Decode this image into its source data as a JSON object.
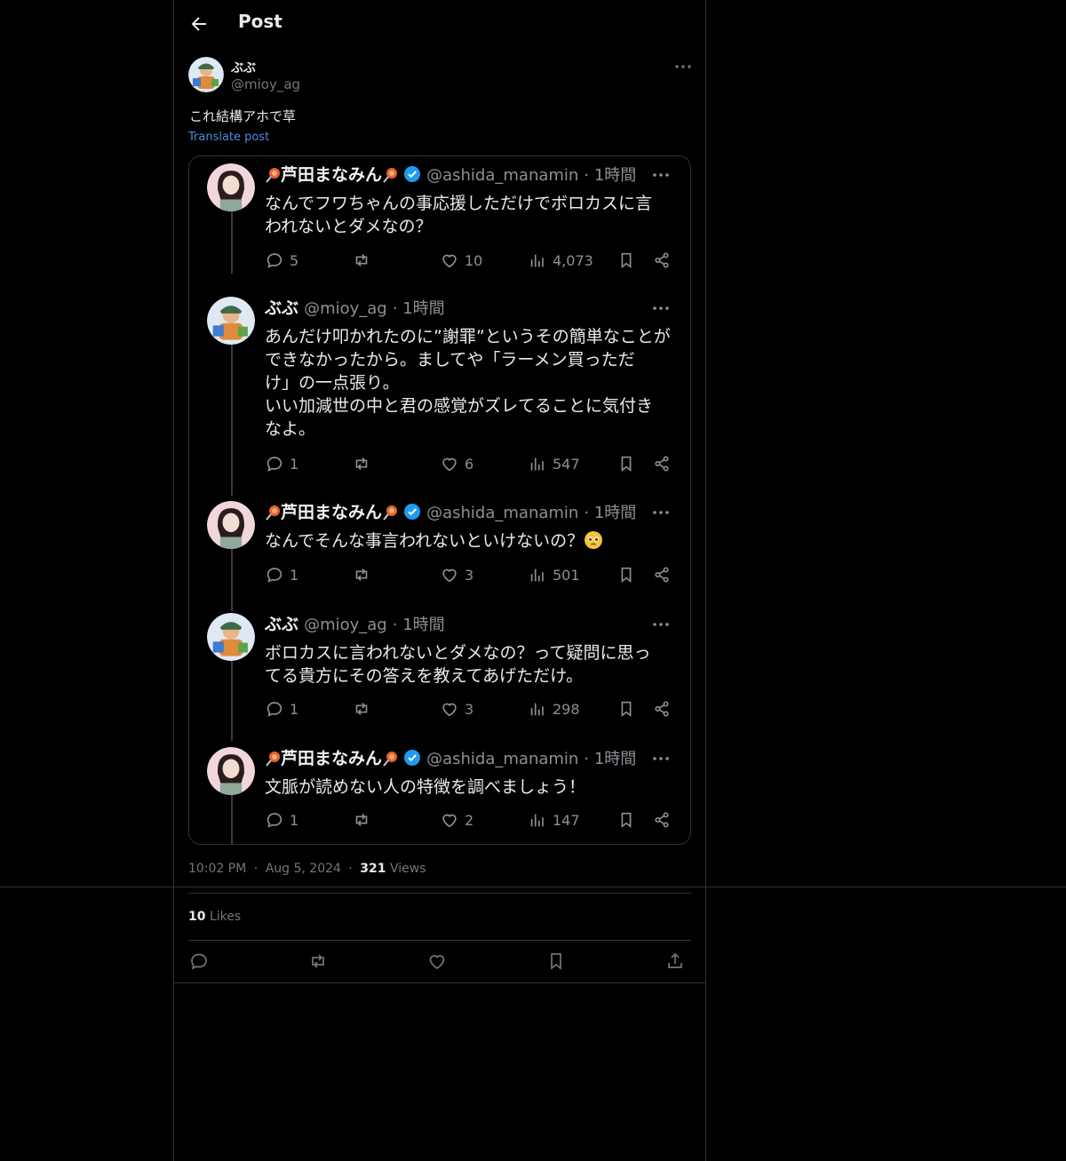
{
  "header": {
    "title": "Post"
  },
  "author": {
    "name": "ぶぶ",
    "handle": "@mioy_ag"
  },
  "post": {
    "text": "これ結構アホで草",
    "translate_label": "Translate post"
  },
  "embedded_thread": [
    {
      "name": "芦田まなみん",
      "verified": true,
      "handle": "@ashida_manamin",
      "time": "· 1時間",
      "body": "なんでフワちゃんの事応援しただけでボロカスに言\nわれないとダメなの？",
      "replies": "5",
      "likes": "10",
      "views": "4,073"
    },
    {
      "name": "ぶぶ",
      "verified": false,
      "handle": "@mioy_ag",
      "time": "· 1時間",
      "body": "あんだけ叩かれたのに”謝罪”というその簡単なことが\nできなかったから。ましてや「ラーメン買っただ\nけ」の一点張り。\nいい加減世の中と君の感覚がズレてることに気付き\nなよ。",
      "replies": "1",
      "likes": "6",
      "views": "547"
    },
    {
      "name": "芦田まなみん",
      "verified": true,
      "handle": "@ashida_manamin",
      "time": "· 1時間",
      "body": "なんでそんな事言われないといけないの？",
      "replies": "1",
      "likes": "3",
      "views": "501"
    },
    {
      "name": "ぶぶ",
      "verified": false,
      "handle": "@mioy_ag",
      "time": "· 1時間",
      "body": "ボロカスに言われないとダメなの？って疑問に思っ\nてる貴方にその答えを教えてあげただけ。",
      "replies": "1",
      "likes": "3",
      "views": "298"
    },
    {
      "name": "芦田まなみん",
      "verified": true,
      "handle": "@ashida_manamin",
      "time": "· 1時間",
      "body": "文脈が読めない人の特徴を調べましょう！",
      "replies": "1",
      "likes": "2",
      "views": "147"
    }
  ],
  "meta": {
    "time": "10:02 PM",
    "sep": "·",
    "date": "Aug 5, 2024",
    "views_count": "321",
    "views_label": "Views"
  },
  "likes": {
    "count": "10",
    "label": "Likes"
  },
  "colors": {
    "background": "#000000",
    "border": "#2f3336",
    "link": "#4a8cd8",
    "verified": "#1d9bf0"
  }
}
